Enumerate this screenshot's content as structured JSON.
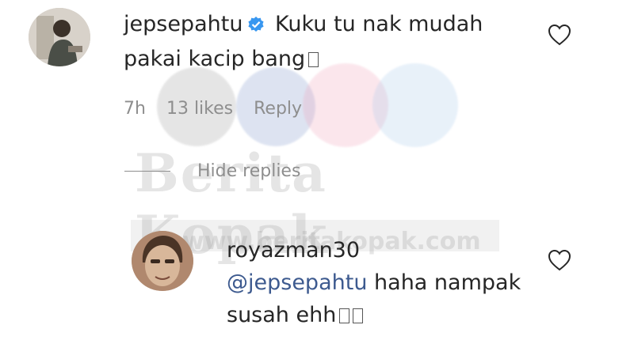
{
  "comment": {
    "username": "jepsepahtu",
    "text": "Kuku tu nak mudah pakai kacip bang",
    "time": "7h",
    "likes": "13 likes",
    "reply_label": "Reply",
    "verified": true
  },
  "replies_toggle": {
    "label": "Hide replies"
  },
  "reply": {
    "username": "royazman30",
    "mention": "@jepsepahtu",
    "text": "haha nampak susah ehh"
  },
  "watermark": {
    "title": "Berita Kopak",
    "url": "www.beritakopak.com"
  },
  "colors": {
    "text": "#262626",
    "meta": "#8e8e8e",
    "mention": "#3d5a8f",
    "verified": "#3897f0"
  },
  "icons": {
    "like": "heart-outline-icon",
    "verified": "verified-badge-icon"
  }
}
